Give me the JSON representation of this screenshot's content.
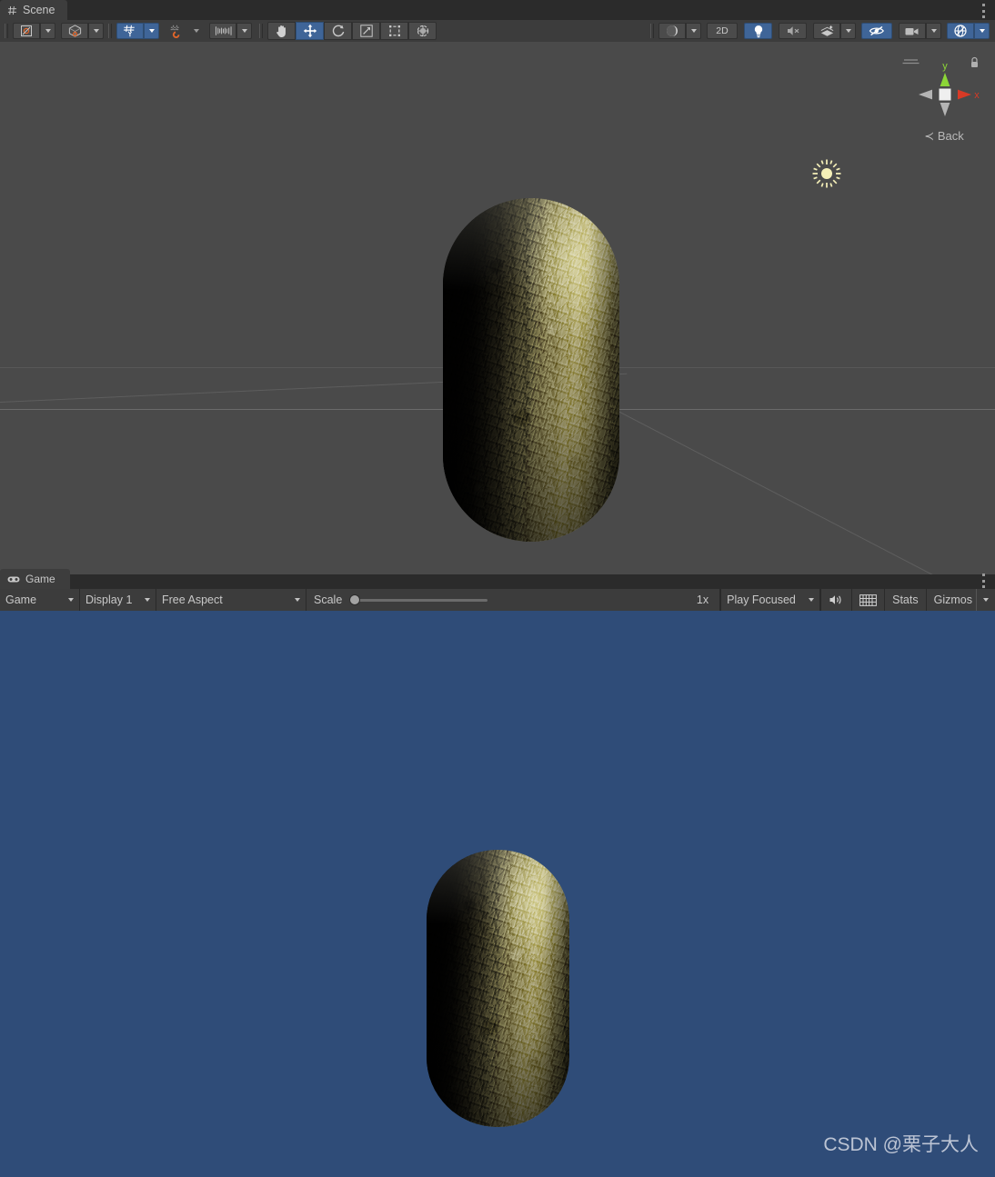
{
  "scene": {
    "tab": {
      "label": "Scene",
      "icon": "grid-icon"
    },
    "menu_icon": "kebab-menu-icon",
    "toolbar_left": [
      {
        "name": "pivot-mode",
        "icon": "pivot-center-icon",
        "has_dropdown": true,
        "active": false
      },
      {
        "name": "pivot-rotation",
        "icon": "global-handle-icon",
        "has_dropdown": true,
        "active": false
      },
      {
        "name": "grid-snapping",
        "icon": "grid-snap-icon",
        "has_dropdown": true,
        "active": true
      },
      {
        "name": "grid-visibility",
        "icon": "grid-magnet-icon",
        "has_dropdown": true,
        "active": false
      },
      {
        "name": "snap-increment",
        "icon": "snap-increment-icon",
        "has_dropdown": true,
        "active": false
      }
    ],
    "tools": [
      {
        "name": "hand-tool",
        "icon": "hand-icon",
        "active": false
      },
      {
        "name": "move-tool",
        "icon": "move-icon",
        "active": true
      },
      {
        "name": "rotate-tool",
        "icon": "rotate-icon",
        "active": false
      },
      {
        "name": "scale-tool",
        "icon": "scale-icon",
        "active": false
      },
      {
        "name": "rect-tool",
        "icon": "rect-transform-icon",
        "active": false
      },
      {
        "name": "transform-tool",
        "icon": "transform-icon",
        "active": false
      }
    ],
    "toolbar_right": [
      {
        "name": "draw-mode",
        "label": "",
        "icon": "shaded-sphere-icon",
        "has_dropdown": true,
        "active": false
      },
      {
        "name": "2d-toggle",
        "label": "2D",
        "icon": "",
        "has_dropdown": false,
        "active": false
      },
      {
        "name": "scene-lighting",
        "label": "",
        "icon": "lightbulb-icon",
        "has_dropdown": false,
        "active": true
      },
      {
        "name": "scene-audio",
        "label": "",
        "icon": "audio-mute-icon",
        "has_dropdown": false,
        "active": false
      },
      {
        "name": "scene-fx",
        "label": "",
        "icon": "fx-icon",
        "has_dropdown": true,
        "active": false
      },
      {
        "name": "scene-visibility",
        "label": "",
        "icon": "hidden-eye-icon",
        "has_dropdown": false,
        "active": true
      },
      {
        "name": "scene-camera",
        "label": "",
        "icon": "camera-icon",
        "has_dropdown": true,
        "active": false
      },
      {
        "name": "gizmos-toggle",
        "label": "",
        "icon": "gizmos-globe-icon",
        "has_dropdown": true,
        "active": true
      }
    ],
    "gizmo": {
      "axis_x": "x",
      "axis_y": "y",
      "view_label": "Back",
      "lock_icon": "lock-icon",
      "persp_icon": "perspective-lines-icon"
    },
    "light_gizmo_icon": "directional-light-sun-icon"
  },
  "game": {
    "tab": {
      "label": "Game",
      "icon": "gamepad-icon"
    },
    "menu_icon": "kebab-menu-icon",
    "controls": {
      "view_mode": "Game",
      "display": "Display 1",
      "aspect": "Free Aspect",
      "scale_label": "Scale",
      "scale_value": "1x",
      "play_mode": "Play Focused",
      "mute_icon": "audio-speaker-icon",
      "stats_toggle_icon": "stats-grid-icon",
      "stats_label": "Stats",
      "gizmos_label": "Gizmos"
    },
    "watermark": "CSDN @栗子大人"
  },
  "colors": {
    "scene_background": "#4a4a4a",
    "game_background": "#2f4c78",
    "accent_active": "#3f6598",
    "chrome": "#3c3c3c",
    "axis_y": "#8cd637",
    "axis_x": "#d83a26",
    "sun": "#f5f0b8"
  }
}
